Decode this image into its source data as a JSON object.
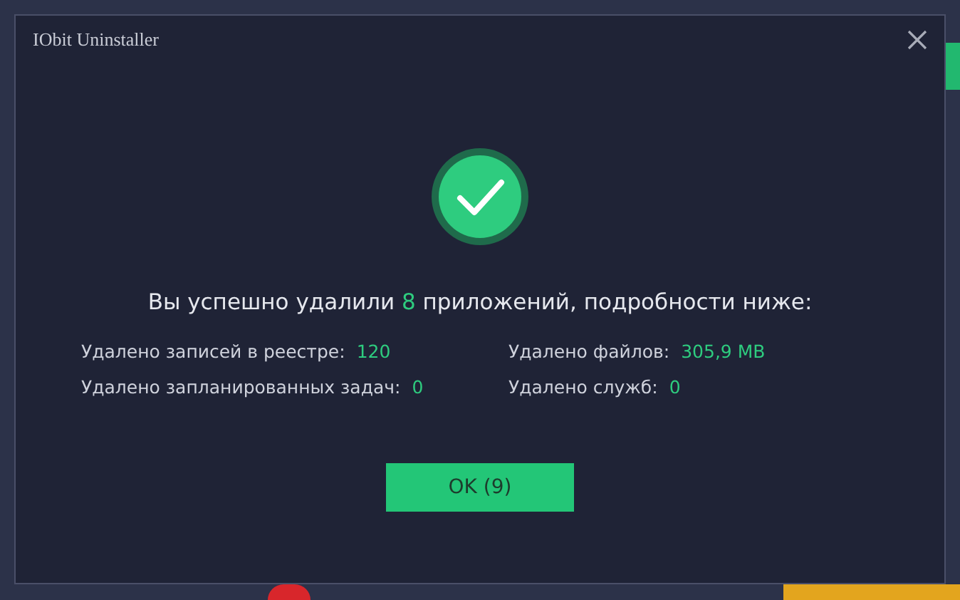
{
  "window": {
    "title": "IObit Uninstaller"
  },
  "headline": {
    "before": "Вы успешно удалили ",
    "count": "8",
    "after": " приложений, подробности ниже:"
  },
  "stats": [
    {
      "label": "Удалено записей в реестре:",
      "value": "120"
    },
    {
      "label": "Удалено файлов:",
      "value": "305,9 MB"
    },
    {
      "label": "Удалено запланированных задач:",
      "value": "0"
    },
    {
      "label": "Удалено служб:",
      "value": "0"
    }
  ],
  "buttons": [
    "OK (9)"
  ]
}
